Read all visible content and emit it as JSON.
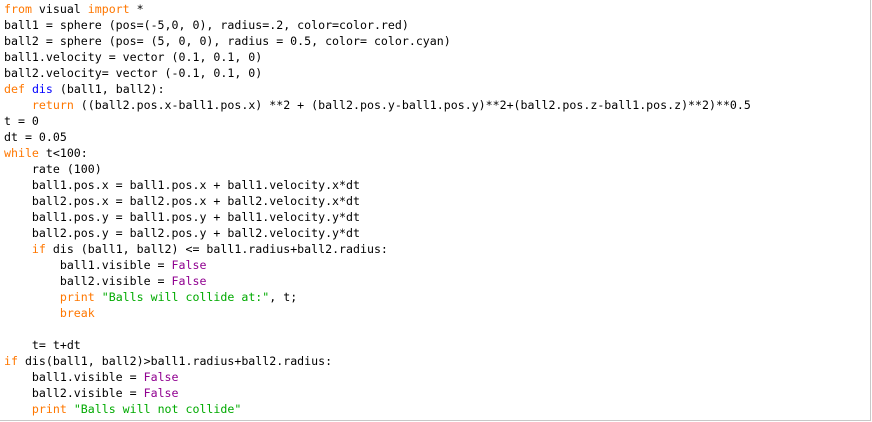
{
  "editor": {
    "lines": [
      [
        {
          "t": "from",
          "c": "kw"
        },
        {
          "t": " visual ",
          "c": ""
        },
        {
          "t": "import",
          "c": "kw"
        },
        {
          "t": " *",
          "c": ""
        }
      ],
      [
        {
          "t": "ball1 = sphere (pos=(-5,0, 0), radius=.2, color=color.red)",
          "c": ""
        }
      ],
      [
        {
          "t": "ball2 = sphere (pos= (5, 0, 0), radius = 0.5, color= color.cyan)",
          "c": ""
        }
      ],
      [
        {
          "t": "ball1.velocity = vector (0.1, 0.1, 0)",
          "c": ""
        }
      ],
      [
        {
          "t": "ball2.velocity= vector (-0.1, 0.1, 0)",
          "c": ""
        }
      ],
      [
        {
          "t": "def",
          "c": "kw"
        },
        {
          "t": " ",
          "c": ""
        },
        {
          "t": "dis",
          "c": "fn"
        },
        {
          "t": " (ball1, ball2):",
          "c": ""
        }
      ],
      [
        {
          "t": "    ",
          "c": ""
        },
        {
          "t": "return",
          "c": "kw"
        },
        {
          "t": " ((ball2.pos.x-ball1.pos.x) **2 + (ball2.pos.y-ball1.pos.y)**2+(ball2.pos.z-ball1.pos.z)**2)**0.5",
          "c": ""
        }
      ],
      [
        {
          "t": "t = 0",
          "c": ""
        }
      ],
      [
        {
          "t": "dt = 0.05",
          "c": ""
        }
      ],
      [
        {
          "t": "while",
          "c": "kw"
        },
        {
          "t": " t<100:",
          "c": ""
        }
      ],
      [
        {
          "t": "    rate (100)",
          "c": ""
        }
      ],
      [
        {
          "t": "    ball1.pos.x = ball1.pos.x + ball1.velocity.x*dt",
          "c": ""
        }
      ],
      [
        {
          "t": "    ball2.pos.x = ball2.pos.x + ball2.velocity.x*dt",
          "c": ""
        }
      ],
      [
        {
          "t": "    ball1.pos.y = ball1.pos.y + ball1.velocity.y*dt",
          "c": ""
        }
      ],
      [
        {
          "t": "    ball2.pos.y = ball2.pos.y + ball2.velocity.y*dt",
          "c": ""
        }
      ],
      [
        {
          "t": "    ",
          "c": ""
        },
        {
          "t": "if",
          "c": "kw"
        },
        {
          "t": " dis (ball1, ball2) <= ball1.radius+ball2.radius:",
          "c": ""
        }
      ],
      [
        {
          "t": "        ball1.visible = ",
          "c": ""
        },
        {
          "t": "False",
          "c": "bi"
        }
      ],
      [
        {
          "t": "        ball2.visible = ",
          "c": ""
        },
        {
          "t": "False",
          "c": "bi"
        }
      ],
      [
        {
          "t": "        ",
          "c": ""
        },
        {
          "t": "print",
          "c": "kw"
        },
        {
          "t": " ",
          "c": ""
        },
        {
          "t": "\"Balls will collide at:\"",
          "c": "str"
        },
        {
          "t": ", t;",
          "c": ""
        }
      ],
      [
        {
          "t": "        ",
          "c": ""
        },
        {
          "t": "break",
          "c": "kw"
        }
      ],
      [
        {
          "t": "",
          "c": ""
        }
      ],
      [
        {
          "t": "    t= t+dt",
          "c": ""
        }
      ],
      [
        {
          "t": "if",
          "c": "kw"
        },
        {
          "t": " dis(ball1, ball2)>ball1.radius+ball2.radius:",
          "c": ""
        }
      ],
      [
        {
          "t": "    ball1.visible = ",
          "c": ""
        },
        {
          "t": "False",
          "c": "bi"
        }
      ],
      [
        {
          "t": "    ball2.visible = ",
          "c": ""
        },
        {
          "t": "False",
          "c": "bi"
        }
      ],
      [
        {
          "t": "    ",
          "c": ""
        },
        {
          "t": "print",
          "c": "kw"
        },
        {
          "t": " ",
          "c": ""
        },
        {
          "t": "\"Balls will not collide\"",
          "c": "str"
        }
      ]
    ]
  },
  "colors": {
    "keyword": "#ff7700",
    "builtin": "#900090",
    "string": "#00aa00",
    "definition": "#0000ff",
    "text": "#000000",
    "background": "#ffffff"
  }
}
